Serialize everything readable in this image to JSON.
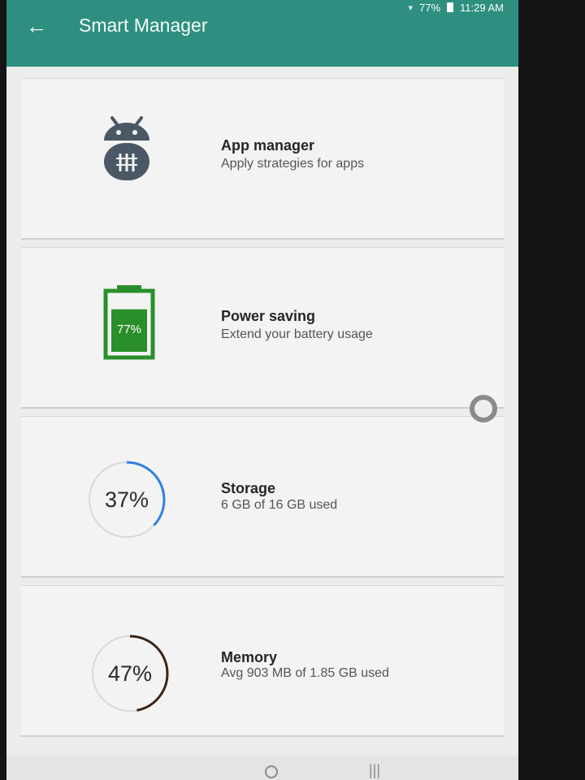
{
  "status_bar": {
    "battery": "77%",
    "time": "11:29 AM"
  },
  "header": {
    "title": "Smart Manager"
  },
  "items": [
    {
      "title": "App manager",
      "subtitle": "Apply strategies for apps",
      "icon": "android-icon"
    },
    {
      "title": "Power saving",
      "subtitle": "Extend your battery usage",
      "icon": "battery-icon",
      "battery_percent": "77%",
      "battery_level": 0.77
    },
    {
      "title": "Storage",
      "subtitle": "6 GB  of 16 GB  used",
      "percent_label": "37%",
      "percent": 0.37,
      "ring_color": "#2f7fe0"
    },
    {
      "title": "Memory",
      "subtitle": "Avg 903 MB  of 1.85 GB  used",
      "percent_label": "47%",
      "percent": 0.47,
      "ring_color": "#3a2418"
    }
  ],
  "colors": {
    "app_bar": "#2e8f80",
    "battery_green": "#2a8f2a",
    "android_icon": "#4a5866",
    "ring_track": "#d8d8d8"
  }
}
